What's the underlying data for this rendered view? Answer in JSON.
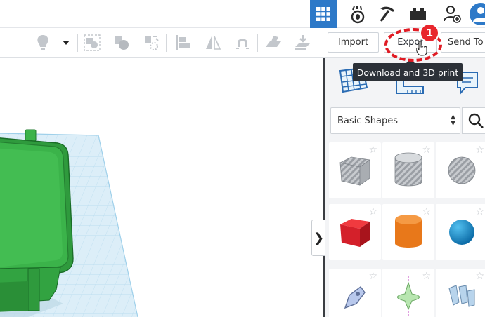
{
  "toolbar": {
    "import_label": "Import",
    "export_label": "Export",
    "export_visible": "Expor",
    "send_to_label": "Send To"
  },
  "tooltip": {
    "text": "Download and 3D print"
  },
  "annotation": {
    "badge": "1",
    "color": "#e01b24"
  },
  "panel": {
    "shape_library": "Basic Shapes",
    "shapes": [
      {
        "name": "Box (hole)",
        "icon": "striped-box-icon"
      },
      {
        "name": "Cylinder (hole)",
        "icon": "striped-cylinder-icon"
      },
      {
        "name": "Sphere (hole)",
        "icon": "striped-sphere-icon"
      },
      {
        "name": "Box",
        "icon": "red-box-icon",
        "color": "#d4202a"
      },
      {
        "name": "Cylinder",
        "icon": "orange-cylinder-icon",
        "color": "#e8781a"
      },
      {
        "name": "Sphere",
        "icon": "blue-sphere-icon",
        "color": "#1a8fd0"
      },
      {
        "name": "Scribble",
        "icon": "scribble-icon"
      },
      {
        "name": "Shape Generator",
        "icon": "shape-generator-icon"
      },
      {
        "name": "Text",
        "icon": "text-shape-icon"
      }
    ]
  },
  "colors": {
    "accent": "#2d79c8",
    "workplane": "#dceef8",
    "model": "#3bb34a"
  }
}
